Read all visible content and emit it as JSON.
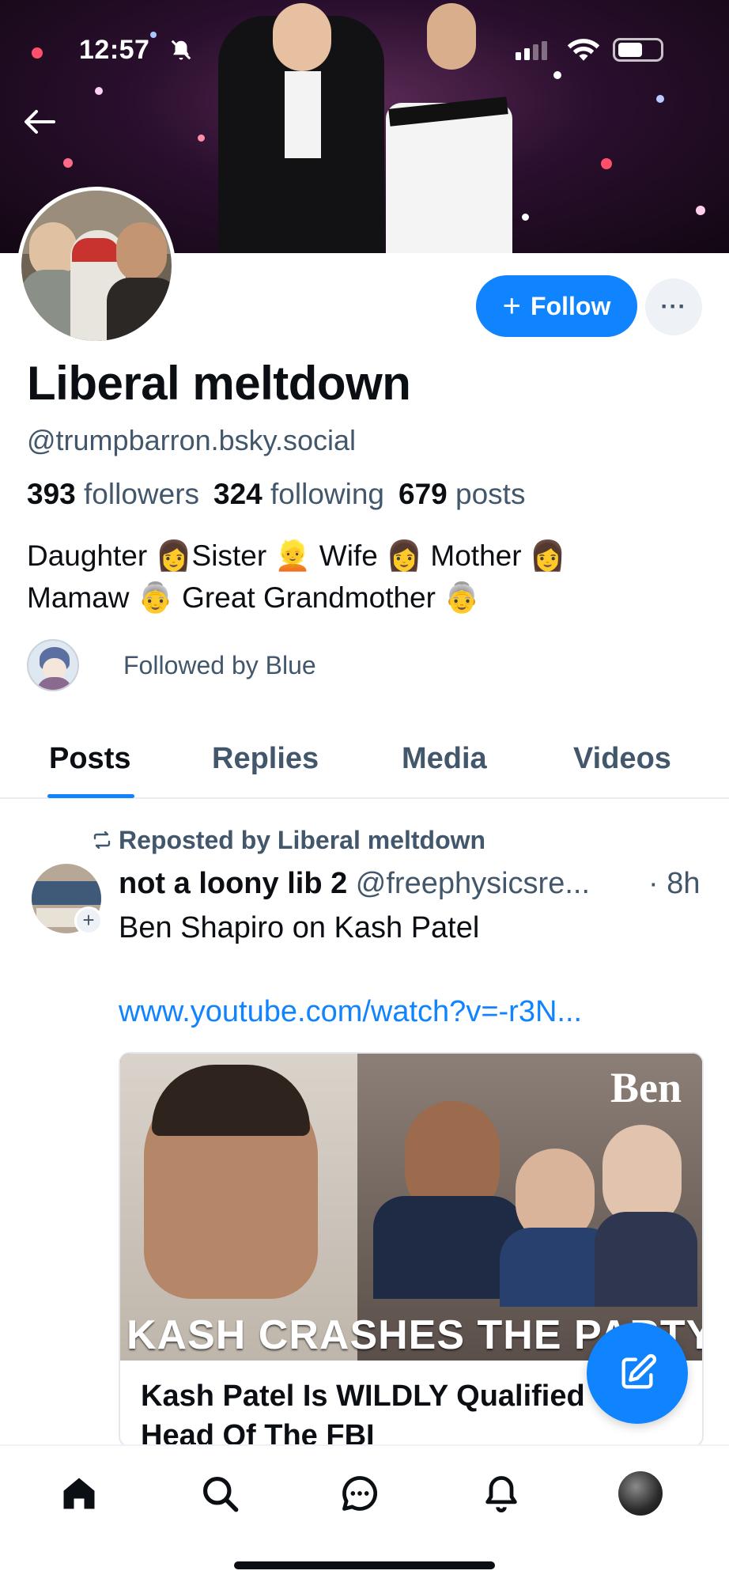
{
  "status_bar": {
    "time": "12:57"
  },
  "profile": {
    "display_name": "Liberal meltdown",
    "handle": "@trumpbarron.bsky.social",
    "followers_count": "393",
    "followers_label": "followers",
    "following_count": "324",
    "following_label": "following",
    "posts_count": "679",
    "posts_label": "posts",
    "bio_line1": "Daughter 👩Sister 👱 Wife 👩 Mother 👩",
    "bio_line2": "Mamaw 👵 Great Grandmother 👵",
    "followed_by": "Followed by Blue"
  },
  "actions": {
    "follow_label": "Follow",
    "more_label": "···"
  },
  "tabs": [
    {
      "label": "Posts",
      "active": true
    },
    {
      "label": "Replies",
      "active": false
    },
    {
      "label": "Media",
      "active": false
    },
    {
      "label": "Videos",
      "active": false
    }
  ],
  "post": {
    "repost_label": "Reposted by Liberal meltdown",
    "author_name": "not a loony lib 2",
    "author_handle": "@freephysicsre...",
    "time": "· 8h",
    "text": "Ben Shapiro on Kash Patel",
    "link": "www.youtube.com/watch?v=-r3N...",
    "card": {
      "thumb_brand": "Ben",
      "thumb_caption": "KASH CRASHES THE PARTY",
      "title": "Kash Patel Is WILDLY Qualified To Head Of The FBI"
    }
  },
  "icons": {
    "back": "arrow-left-icon",
    "bell_slash": "bell-slash-icon",
    "signal": "signal-icon",
    "wifi": "wifi-icon",
    "battery": "battery-icon",
    "repost": "repost-icon",
    "compose": "compose-icon",
    "nav": [
      "home-icon",
      "search-icon",
      "chat-icon",
      "bell-icon",
      "profile-avatar"
    ]
  },
  "colors": {
    "accent": "#1083fe",
    "muted": "#42576c",
    "text": "#0b0f14"
  }
}
